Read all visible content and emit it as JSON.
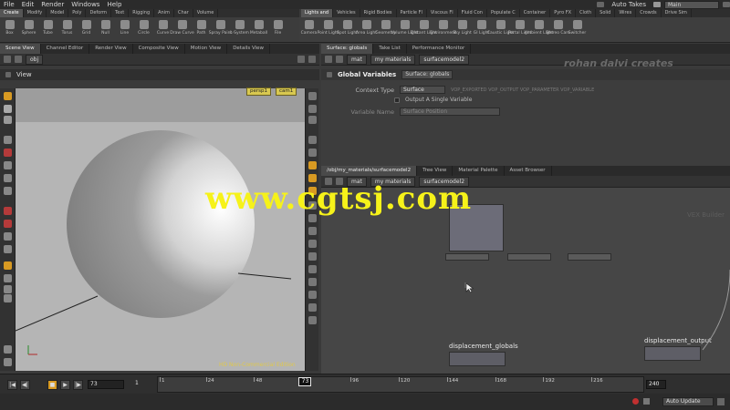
{
  "menubar": {
    "items": [
      "File",
      "Edit",
      "Render",
      "Windows",
      "Help"
    ],
    "auto_takes": "Auto Takes",
    "desktop": "Main"
  },
  "shelf": {
    "tabs_left": [
      "Create",
      "Modify",
      "Model",
      "Poly",
      "Deform",
      "Text",
      "Rigging",
      "Anim",
      "Char",
      "Volume"
    ],
    "tabs_right": [
      "Lights and",
      "Vehicles",
      "Rigid Bodies",
      "Particle Fl",
      "Viscous Fl",
      "Fluid Con",
      "Populate C",
      "Container",
      "Pyro FX",
      "Cloth",
      "Solid",
      "Wires",
      "Crowds",
      "Drive Sim"
    ],
    "tools_left": [
      "Box",
      "Sphere",
      "Tube",
      "Torus",
      "Grid",
      "Null",
      "Line",
      "Circle",
      "Curve",
      "Draw Curve",
      "Path",
      "Spray Paint",
      "L-System",
      "Metaball",
      "File"
    ],
    "tools_right": [
      "Camera",
      "Point Light",
      "Spot Light",
      "Area Light",
      "Geometry",
      "Volume Light",
      "Distant Light",
      "Environment",
      "Sky Light",
      "GI Light",
      "Caustic Light",
      "Portal Light",
      "Ambient Light",
      "Stereo Cam",
      "Switcher"
    ]
  },
  "left_pane": {
    "tabs": [
      "Scene View",
      "Channel Editor",
      "Render View",
      "Composite View",
      "Motion View",
      "Details View"
    ],
    "path": "obj",
    "view_label": "View",
    "camera_menu": "persp1",
    "camera2_menu": "cam1",
    "watermark_license": "HD Non-Commercial Edition"
  },
  "right_top": {
    "tabs": [
      "Surface: globals",
      "Take List",
      "Performance Monitor"
    ],
    "path_segments": [
      "mat",
      "my materials",
      "surfacemodel2"
    ],
    "node_header": "Global Variables",
    "node_name": "Surface: globals",
    "params": {
      "context_label": "Context Type",
      "context_value": "Surface",
      "context_vars": "VOP_EXPORTED VOP_OUTPUT VOP_PARAMETER VOP_VARIABLE",
      "output_single_label": "Output A Single Variable",
      "var_name_label": "Variable Name",
      "var_name_value": "Surface Position"
    }
  },
  "right_bottom": {
    "tabs": [
      "/obj/my_materials/surfacemodel2",
      "Tree View",
      "Material Palette",
      "Asset Browser"
    ],
    "path_segments": [
      "mat",
      "my materials",
      "surfacemodel2"
    ],
    "nodes": [
      {
        "name": "displacement_globals"
      },
      {
        "name": "displacement_output"
      }
    ],
    "context_label": "VEX Builder"
  },
  "branding": {
    "url": "www.cgtsj.com",
    "author": "rohan dalvi creates"
  },
  "timeline": {
    "current_frame": "73",
    "start_frame": "1",
    "end_frame": "240",
    "ticks": [
      "1",
      "24",
      "48",
      "73",
      "96",
      "120",
      "144",
      "168",
      "192",
      "216"
    ],
    "tick_frames": [
      1,
      24,
      48,
      73,
      96,
      120,
      144,
      168,
      192,
      216
    ],
    "range": [
      1,
      240
    ],
    "buttons": {
      "first": "|◀",
      "prev": "◀|",
      "stop": "■",
      "play": "▶",
      "next": "|▶",
      "last": "▶|"
    }
  },
  "status": {
    "auto_update": "Auto Update"
  }
}
